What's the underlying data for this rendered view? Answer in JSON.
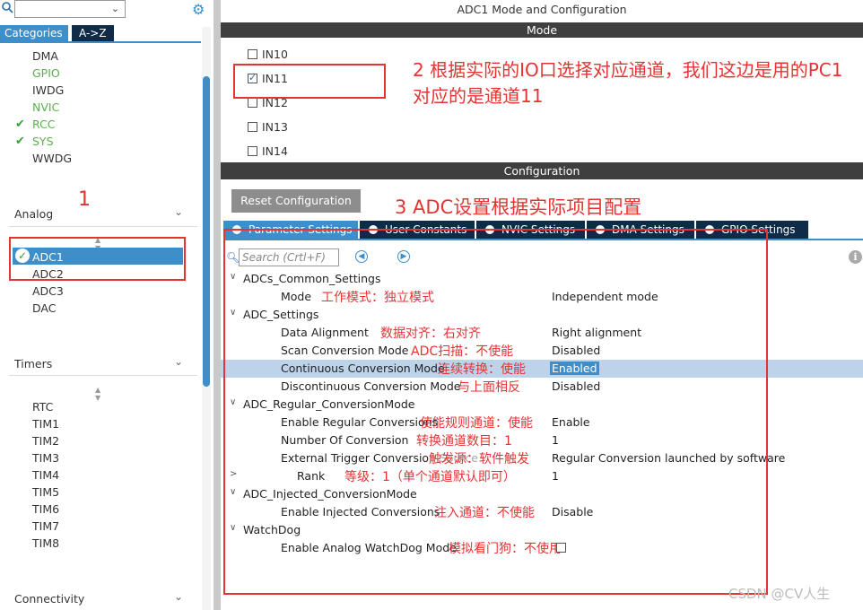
{
  "left": {
    "search_value": "",
    "tabs": [
      "Categories",
      "A->Z"
    ],
    "system_core_items": [
      {
        "label": "DMA",
        "color": "#333333",
        "checked": false
      },
      {
        "label": "GPIO",
        "color": "#58b24a",
        "checked": false
      },
      {
        "label": "IWDG",
        "color": "#333333",
        "checked": false
      },
      {
        "label": "NVIC",
        "color": "#58b24a",
        "checked": false
      },
      {
        "label": "RCC",
        "color": "#58b24a",
        "checked": true
      },
      {
        "label": "SYS",
        "color": "#58b24a",
        "checked": true
      },
      {
        "label": "WWDG",
        "color": "#333333",
        "checked": false
      }
    ],
    "analog": {
      "title": "Analog",
      "items": [
        "ADC1",
        "ADC2",
        "ADC3",
        "DAC"
      ],
      "selected": "ADC1"
    },
    "timers": {
      "title": "Timers",
      "items": [
        "RTC",
        "TIM1",
        "TIM2",
        "TIM3",
        "TIM4",
        "TIM5",
        "TIM6",
        "TIM7",
        "TIM8"
      ]
    },
    "connectivity_title": "Connectivity",
    "annotation_1": "1"
  },
  "right": {
    "title": "ADC1 Mode and Configuration",
    "mode_bar": "Mode",
    "inputs": [
      {
        "label": "IN10",
        "checked": false
      },
      {
        "label": "IN11",
        "checked": true
      },
      {
        "label": "IN12",
        "checked": false
      },
      {
        "label": "IN13",
        "checked": false
      },
      {
        "label": "IN14",
        "checked": false
      }
    ],
    "annotation_2": "2 根据实际的IO口选择对应通道，我们这边是用的PC1对应的是通道11",
    "config_bar": "Configuration",
    "reset_button": "Reset Configuration",
    "annotation_3": "3 ADC设置根据实际项目配置",
    "param_tabs": [
      "Parameter Settings",
      "User Constants",
      "NVIC Settings",
      "DMA Settings",
      "GPIO Settings"
    ],
    "search_placeholder": "Search (Crtl+F)",
    "params": {
      "g1": "ADCs_Common_Settings",
      "mode_key": "Mode",
      "mode_val": "Independent mode",
      "mode_note": "工作模式：独立模式",
      "g2": "ADC_Settings",
      "align_key": "Data Alignment",
      "align_val": "Right alignment",
      "align_note": "数据对齐：右对齐",
      "scan_key": "Scan Conversion Mode",
      "scan_val": "Disabled",
      "scan_note": "ADC扫描：不使能",
      "cont_key": "Continuous Conversion Mode",
      "cont_val": "Enabled",
      "cont_note": "连续转换：使能",
      "disc_key": "Discontinuous Conversion Mode",
      "disc_val": "Disabled",
      "disc_note": "与上面相反",
      "g3": "ADC_Regular_ConversionMode",
      "reg_key": "Enable Regular Conversions",
      "reg_val": "Enable",
      "reg_note": "使能规则通道：使能",
      "num_key": "Number Of Conversion",
      "num_val": "1",
      "num_note": "转换通道数目：1",
      "trig_key": "External Trigger Conversion Source",
      "trig_val": "Regular Conversion launched by software",
      "trig_note": "触发源：软件触发",
      "rank_key": "Rank",
      "rank_val": "1",
      "rank_note": "等级：1（单个通道默认即可）",
      "g4": "ADC_Injected_ConversionMode",
      "inj_key": "Enable Injected Conversions",
      "inj_val": "Disable",
      "inj_note": "注入通道：不使能",
      "g5": "WatchDog",
      "wd_key": "Enable Analog WatchDog Mode",
      "wd_note": "模拟看门狗：不使用"
    }
  },
  "watermark": "CSDN @CV人生"
}
